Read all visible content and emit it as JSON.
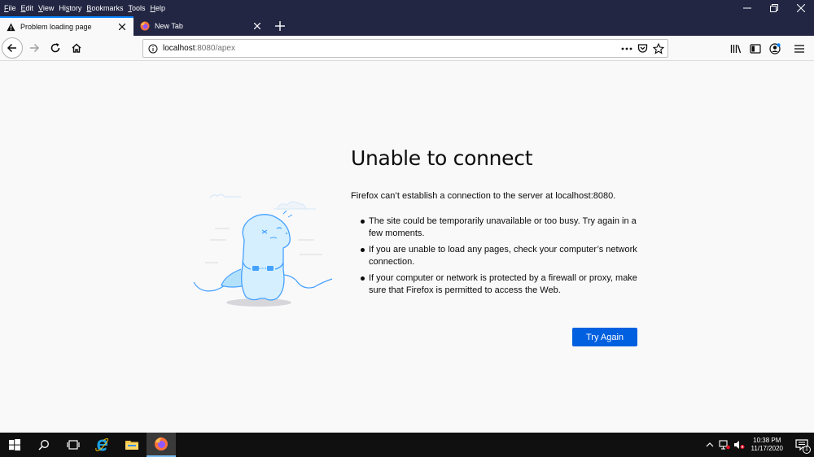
{
  "menu": {
    "items": [
      {
        "accel": "F",
        "rest": "ile"
      },
      {
        "accel": "E",
        "rest": "dit"
      },
      {
        "accel": "V",
        "rest": "iew"
      },
      {
        "pre": "Hi",
        "accel": "s",
        "rest": "tory"
      },
      {
        "accel": "B",
        "rest": "ookmarks"
      },
      {
        "accel": "T",
        "rest": "ools"
      },
      {
        "accel": "H",
        "rest": "elp"
      }
    ]
  },
  "tabs": [
    {
      "title": "Problem loading page",
      "icon": "warning-icon",
      "active": true
    },
    {
      "title": "New Tab",
      "icon": "firefox-icon",
      "active": false
    }
  ],
  "urlbar": {
    "host": "localhost",
    "path": ":8080/apex"
  },
  "error": {
    "title": "Unable to connect",
    "description": "Firefox can’t establish a connection to the server at localhost:8080.",
    "items": [
      "The site could be temporarily unavailable or too busy. Try again in a few moments.",
      "If you are unable to load any pages, check your computer’s network connection.",
      "If your computer or network is protected by a firewall or proxy, make sure that Firefox is permitted to access the Web."
    ],
    "try_again_label": "Try Again"
  },
  "taskbar": {
    "time": "10:38 PM",
    "date": "11/17/2020",
    "notification_count": "1"
  },
  "colors": {
    "titlebar": "#222643",
    "accent": "#0060df",
    "tab_highlight": "#0a84ff"
  }
}
